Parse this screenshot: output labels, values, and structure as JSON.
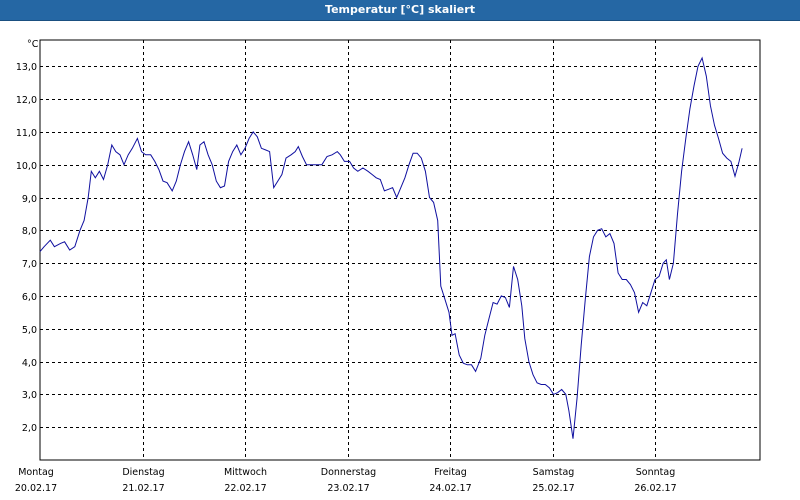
{
  "window": {
    "title": "Temperatur [°C] skaliert"
  },
  "chart_data": {
    "type": "line",
    "title": "Temperatur [°C] skaliert",
    "ylabel": "°C",
    "ylim": [
      1.0,
      13.8
    ],
    "yticks": [
      "2,0",
      "3,0",
      "4,0",
      "5,0",
      "6,0",
      "7,0",
      "8,0",
      "9,0",
      "10,0",
      "11,0",
      "12,0",
      "13,0"
    ],
    "ytick_values": [
      2,
      3,
      4,
      5,
      6,
      7,
      8,
      9,
      10,
      11,
      12,
      13
    ],
    "x_range_days": [
      0,
      7.04
    ],
    "xticks": [
      {
        "day": "Montag",
        "date": "20.02.17"
      },
      {
        "day": "Dienstag",
        "date": "21.02.17"
      },
      {
        "day": "Mittwoch",
        "date": "22.02.17"
      },
      {
        "day": "Donnerstag",
        "date": "23.02.17"
      },
      {
        "day": "Freitag",
        "date": "24.02.17"
      },
      {
        "day": "Samstag",
        "date": "25.02.17"
      },
      {
        "day": "Sonntag",
        "date": "26.02.17"
      }
    ],
    "grid": true,
    "line_color": "#1010a0",
    "series": [
      {
        "points": [
          [
            0.0,
            7.35
          ],
          [
            0.04,
            7.5
          ],
          [
            0.1,
            7.7
          ],
          [
            0.14,
            7.5
          ],
          [
            0.2,
            7.6
          ],
          [
            0.24,
            7.65
          ],
          [
            0.29,
            7.4
          ],
          [
            0.34,
            7.5
          ],
          [
            0.39,
            8.0
          ],
          [
            0.43,
            8.3
          ],
          [
            0.47,
            9.0
          ],
          [
            0.5,
            9.8
          ],
          [
            0.54,
            9.6
          ],
          [
            0.58,
            9.8
          ],
          [
            0.62,
            9.55
          ],
          [
            0.66,
            10.0
          ],
          [
            0.7,
            10.6
          ],
          [
            0.74,
            10.4
          ],
          [
            0.78,
            10.3
          ],
          [
            0.82,
            10.0
          ],
          [
            0.86,
            10.3
          ],
          [
            0.9,
            10.5
          ],
          [
            0.95,
            10.8
          ],
          [
            0.99,
            10.4
          ],
          [
            1.03,
            10.3
          ],
          [
            1.08,
            10.3
          ],
          [
            1.12,
            10.1
          ],
          [
            1.16,
            9.85
          ],
          [
            1.2,
            9.5
          ],
          [
            1.24,
            9.45
          ],
          [
            1.29,
            9.2
          ],
          [
            1.33,
            9.5
          ],
          [
            1.37,
            10.0
          ],
          [
            1.41,
            10.4
          ],
          [
            1.45,
            10.7
          ],
          [
            1.49,
            10.3
          ],
          [
            1.53,
            9.85
          ],
          [
            1.56,
            10.6
          ],
          [
            1.6,
            10.7
          ],
          [
            1.64,
            10.3
          ],
          [
            1.68,
            10.0
          ],
          [
            1.72,
            9.5
          ],
          [
            1.76,
            9.3
          ],
          [
            1.8,
            9.35
          ],
          [
            1.84,
            10.1
          ],
          [
            1.88,
            10.4
          ],
          [
            1.92,
            10.6
          ],
          [
            1.96,
            10.3
          ],
          [
            2.0,
            10.5
          ],
          [
            2.04,
            10.8
          ],
          [
            2.08,
            11.0
          ],
          [
            2.12,
            10.85
          ],
          [
            2.16,
            10.5
          ],
          [
            2.2,
            10.45
          ],
          [
            2.24,
            10.4
          ],
          [
            2.28,
            9.3
          ],
          [
            2.32,
            9.5
          ],
          [
            2.36,
            9.7
          ],
          [
            2.4,
            10.2
          ],
          [
            2.45,
            10.3
          ],
          [
            2.49,
            10.4
          ],
          [
            2.52,
            10.55
          ],
          [
            2.56,
            10.25
          ],
          [
            2.6,
            10.0
          ],
          [
            2.65,
            10.0
          ],
          [
            2.7,
            10.0
          ],
          [
            2.75,
            10.0
          ],
          [
            2.8,
            10.25
          ],
          [
            2.85,
            10.3
          ],
          [
            2.9,
            10.4
          ],
          [
            2.93,
            10.3
          ],
          [
            2.97,
            10.1
          ],
          [
            3.02,
            10.1
          ],
          [
            3.06,
            9.9
          ],
          [
            3.1,
            9.8
          ],
          [
            3.15,
            9.9
          ],
          [
            3.2,
            9.8
          ],
          [
            3.24,
            9.7
          ],
          [
            3.28,
            9.6
          ],
          [
            3.32,
            9.55
          ],
          [
            3.36,
            9.2
          ],
          [
            3.4,
            9.25
          ],
          [
            3.44,
            9.3
          ],
          [
            3.48,
            9.0
          ],
          [
            3.52,
            9.3
          ],
          [
            3.56,
            9.6
          ],
          [
            3.6,
            10.0
          ],
          [
            3.64,
            10.35
          ],
          [
            3.68,
            10.35
          ],
          [
            3.72,
            10.2
          ],
          [
            3.76,
            9.8
          ],
          [
            3.8,
            9.0
          ],
          [
            3.84,
            8.85
          ],
          [
            3.88,
            8.3
          ],
          [
            3.91,
            6.3
          ],
          [
            3.95,
            5.9
          ],
          [
            3.99,
            5.5
          ],
          [
            4.02,
            4.8
          ],
          [
            4.05,
            4.85
          ],
          [
            4.09,
            4.2
          ],
          [
            4.13,
            3.95
          ],
          [
            4.17,
            3.9
          ],
          [
            4.21,
            3.9
          ],
          [
            4.25,
            3.7
          ],
          [
            4.3,
            4.1
          ],
          [
            4.34,
            4.8
          ],
          [
            4.38,
            5.3
          ],
          [
            4.42,
            5.8
          ],
          [
            4.46,
            5.75
          ],
          [
            4.5,
            6.0
          ],
          [
            4.54,
            5.95
          ],
          [
            4.58,
            5.65
          ],
          [
            4.62,
            6.9
          ],
          [
            4.66,
            6.5
          ],
          [
            4.7,
            5.7
          ],
          [
            4.73,
            4.7
          ],
          [
            4.77,
            4.0
          ],
          [
            4.81,
            3.6
          ],
          [
            4.85,
            3.35
          ],
          [
            4.89,
            3.3
          ],
          [
            4.93,
            3.3
          ],
          [
            4.97,
            3.2
          ],
          [
            5.01,
            3.0
          ],
          [
            5.05,
            3.05
          ],
          [
            5.09,
            3.15
          ],
          [
            5.13,
            3.0
          ],
          [
            5.16,
            2.5
          ],
          [
            5.2,
            1.65
          ],
          [
            5.24,
            2.9
          ],
          [
            5.28,
            4.5
          ],
          [
            5.32,
            5.9
          ],
          [
            5.36,
            7.2
          ],
          [
            5.4,
            7.8
          ],
          [
            5.44,
            8.0
          ],
          [
            5.48,
            8.05
          ],
          [
            5.52,
            7.8
          ],
          [
            5.56,
            7.9
          ],
          [
            5.6,
            7.6
          ],
          [
            5.64,
            6.7
          ],
          [
            5.68,
            6.5
          ],
          [
            5.72,
            6.5
          ],
          [
            5.76,
            6.35
          ],
          [
            5.8,
            6.1
          ],
          [
            5.84,
            5.5
          ],
          [
            5.88,
            5.8
          ],
          [
            5.92,
            5.7
          ],
          [
            5.96,
            6.1
          ],
          [
            6.0,
            6.5
          ],
          [
            6.04,
            6.6
          ],
          [
            6.08,
            7.0
          ],
          [
            6.11,
            7.1
          ],
          [
            6.14,
            6.5
          ],
          [
            6.18,
            7.0
          ],
          [
            6.22,
            8.5
          ],
          [
            6.26,
            9.8
          ],
          [
            6.3,
            10.8
          ],
          [
            6.34,
            11.7
          ],
          [
            6.38,
            12.4
          ],
          [
            6.42,
            13.0
          ],
          [
            6.46,
            13.25
          ],
          [
            6.5,
            12.7
          ],
          [
            6.54,
            11.8
          ],
          [
            6.58,
            11.2
          ],
          [
            6.62,
            10.8
          ],
          [
            6.66,
            10.35
          ],
          [
            6.7,
            10.2
          ],
          [
            6.74,
            10.1
          ],
          [
            6.78,
            9.65
          ],
          [
            6.82,
            10.1
          ],
          [
            6.85,
            10.5
          ]
        ]
      }
    ]
  }
}
